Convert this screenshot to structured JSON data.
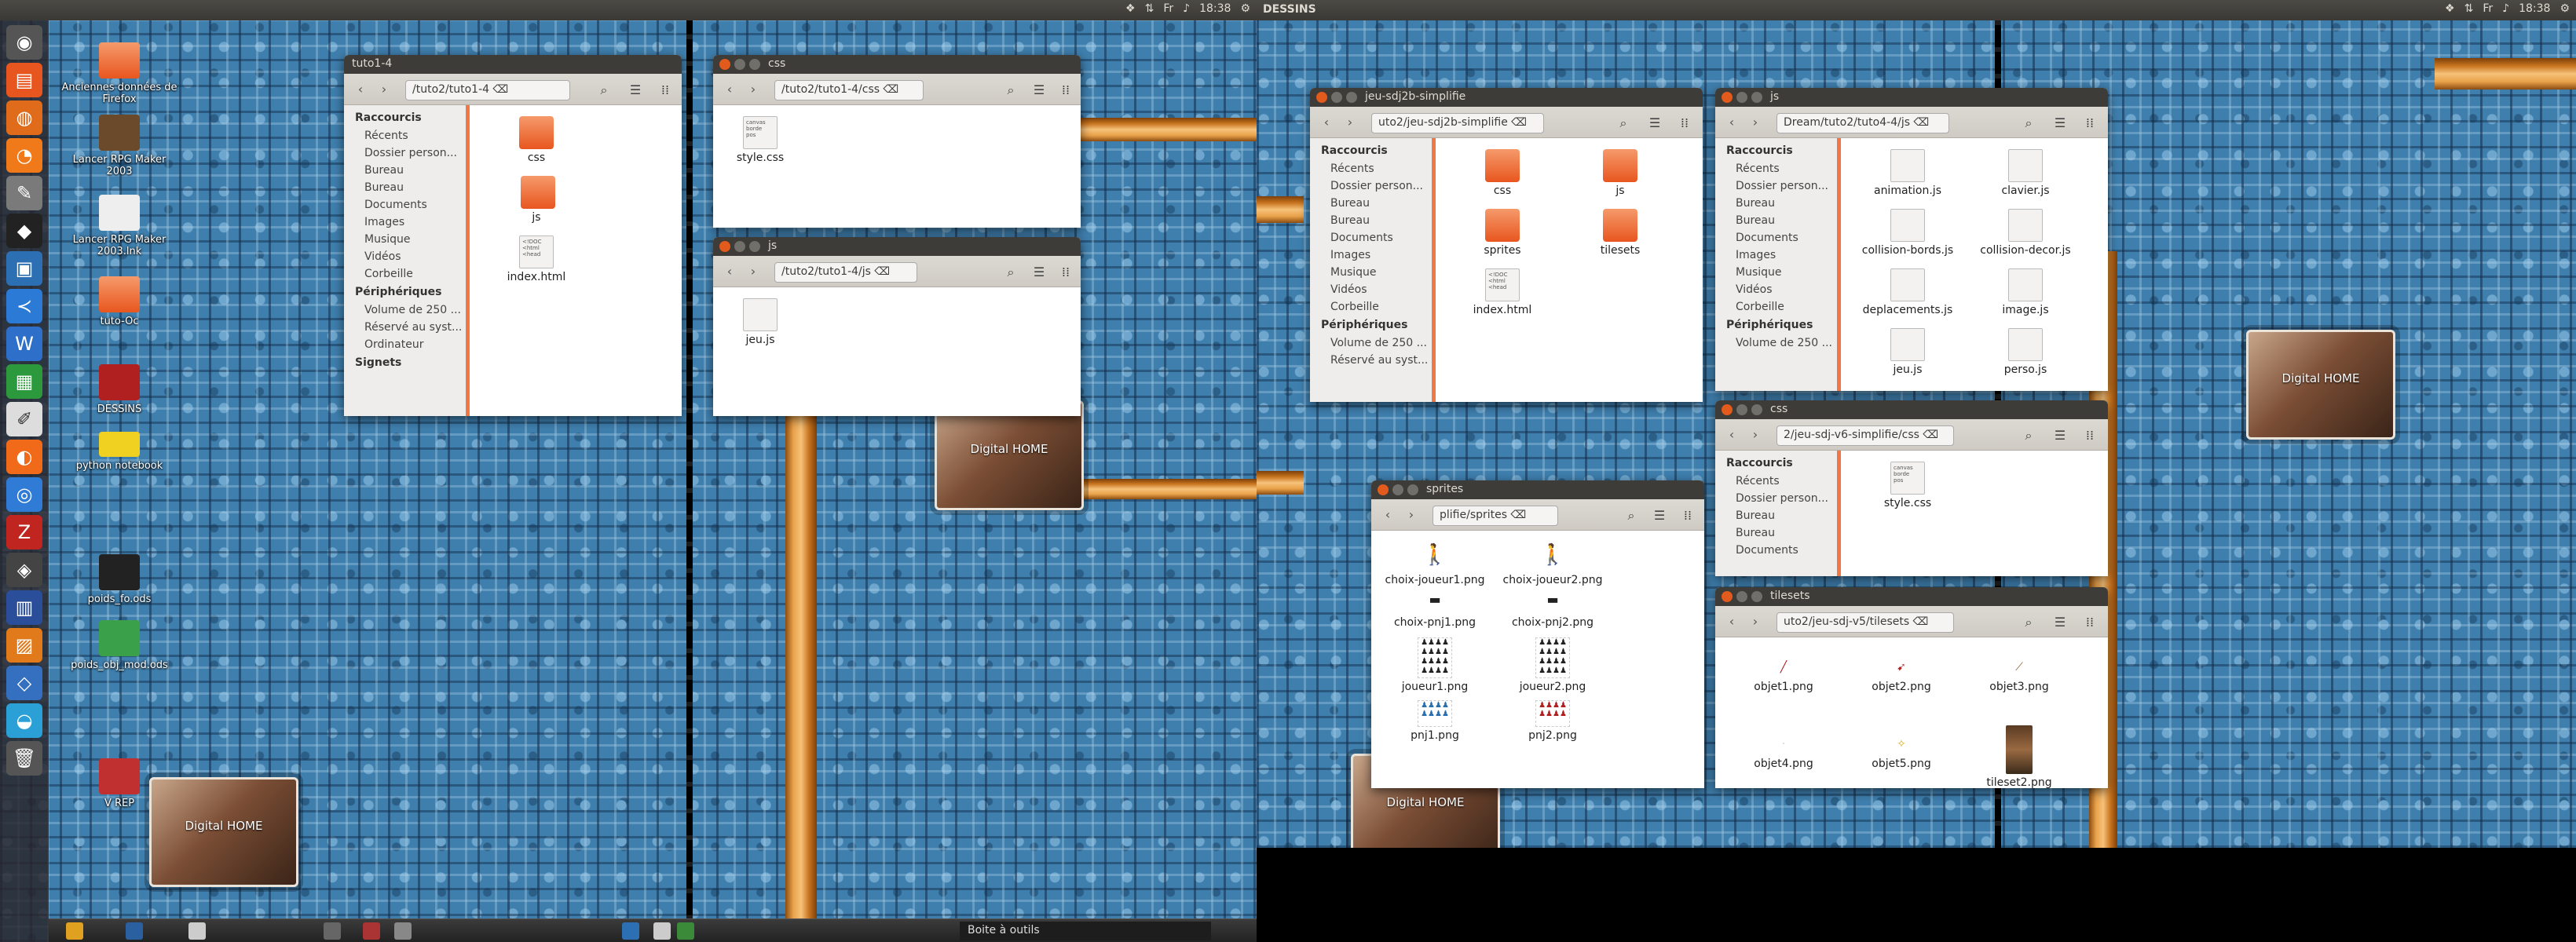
{
  "left_screen": {
    "topbar": {
      "time": "18:38"
    },
    "desktop_icons": [
      "Anciennes données de Firefox",
      "Lancer RPG Maker 2003",
      "Lancer RPG Maker 2003.lnk",
      "tuto-Oc",
      "DESSINS",
      "python notebook",
      "poids_fo.ods",
      "poids_obj_mod.ods",
      "V REP"
    ],
    "bottom_panel": {
      "boite": "Boite à outils"
    },
    "windows": {
      "tuto": {
        "title": "tuto1-4",
        "path": "/tuto2/tuto1-4",
        "sidebar": {
          "raccourcis": "Raccourcis",
          "items": [
            "Récents",
            "Dossier person...",
            "Bureau",
            "Bureau",
            "Documents",
            "Images",
            "Musique",
            "Vidéos",
            "Corbeille"
          ],
          "peripheriques": "Périphériques",
          "devices": [
            "Volume de 250 ...",
            "Réservé au syst...",
            "Ordinateur"
          ],
          "signets": "Signets"
        },
        "files": [
          "css",
          "js",
          "index.html"
        ]
      },
      "css": {
        "title": "css",
        "path": "/tuto2/tuto1-4/css",
        "files": [
          "style.css"
        ]
      },
      "js": {
        "title": "js",
        "path": "/tuto2/tuto1-4/js",
        "files": [
          "jeu.js"
        ]
      }
    }
  },
  "right_screen": {
    "topbar": {
      "title": "DESSINS",
      "time": "18:38"
    },
    "windows": {
      "jeu": {
        "title": "jeu-sdj2b-simplifie",
        "path": "uto2/jeu-sdj2b-simplifie",
        "sidebar": {
          "raccourcis": "Raccourcis",
          "items": [
            "Récents",
            "Dossier person...",
            "Bureau",
            "Bureau",
            "Documents",
            "Images",
            "Musique",
            "Vidéos",
            "Corbeille"
          ],
          "peripheriques": "Périphériques",
          "devices": [
            "Volume de 250 ...",
            "Réservé au syst..."
          ]
        },
        "files": [
          "css",
          "js",
          "sprites",
          "tilesets",
          "index.html"
        ]
      },
      "js": {
        "title": "js",
        "path": "Dream/tuto2/tuto4-4/js",
        "sidebar": {
          "raccourcis": "Raccourcis",
          "items": [
            "Récents",
            "Dossier person...",
            "Bureau",
            "Bureau",
            "Documents",
            "Images",
            "Musique",
            "Vidéos",
            "Corbeille"
          ],
          "peripheriques": "Périphériques",
          "devices": [
            "Volume de 250 ..."
          ]
        },
        "files": [
          "animation.js",
          "clavier.js",
          "collision-bords.js",
          "collision-decor.js",
          "deplacements.js",
          "image.js",
          "jeu.js",
          "perso.js"
        ]
      },
      "css": {
        "title": "css",
        "path": "2/jeu-sdj-v6-simplifie/css",
        "sidebar": {
          "raccourcis": "Raccourcis",
          "items": [
            "Récents",
            "Dossier person...",
            "Bureau",
            "Bureau",
            "Documents"
          ]
        },
        "files": [
          "style.css"
        ]
      },
      "sprites": {
        "title": "sprites",
        "path": "plifie/sprites",
        "files": [
          "choix-joueur1.png",
          "choix-joueur2.png",
          "choix-pnj1.png",
          "choix-pnj2.png",
          "joueur1.png",
          "joueur2.png",
          "pnj1.png",
          "pnj2.png"
        ]
      },
      "tilesets": {
        "title": "tilesets",
        "path": "uto2/jeu-sdj-v5/tilesets",
        "files": [
          "objet1.png",
          "objet2.png",
          "objet3.png",
          "objet4.png",
          "objet5.png",
          "tileset2.png"
        ]
      }
    }
  },
  "wallpaper_label": "Digital HOME",
  "colors": {
    "accent": "#f07746",
    "titlebar": "#3d3c38",
    "close": "#e25a1c"
  }
}
